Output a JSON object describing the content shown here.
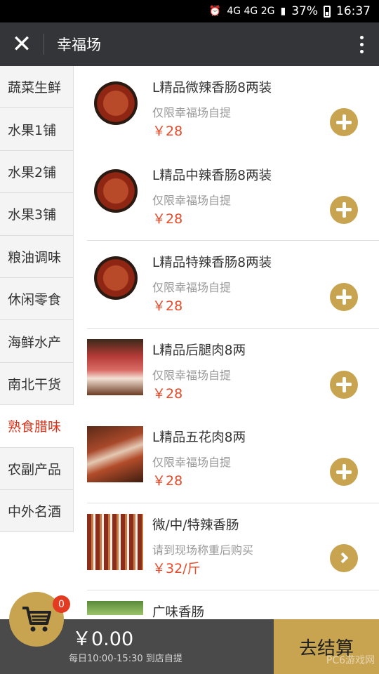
{
  "status_bar": {
    "network": "4G 4G 2G",
    "battery": "37%",
    "time": "16:37"
  },
  "header": {
    "title": "幸福场"
  },
  "sidebar": {
    "items": [
      {
        "label": "蔬菜生鲜"
      },
      {
        "label": "水果1铺"
      },
      {
        "label": "水果2铺"
      },
      {
        "label": "水果3铺"
      },
      {
        "label": "粮油调味"
      },
      {
        "label": "休闲零食"
      },
      {
        "label": "海鲜水产"
      },
      {
        "label": "南北干货"
      },
      {
        "label": "熟食腊味"
      },
      {
        "label": "农副产品"
      },
      {
        "label": "中外名酒"
      }
    ],
    "active_label": "熟食腊味"
  },
  "products": [
    {
      "name": "L精品微辣香肠8两装",
      "note": "仅限幸福场自提",
      "price": "￥28",
      "action": "plus-icon"
    },
    {
      "name": "L精品中辣香肠8两装",
      "note": "仅限幸福场自提",
      "price": "￥28",
      "action": "plus-icon"
    },
    {
      "name": "L精品特辣香肠8两装",
      "note": "仅限幸福场自提",
      "price": "￥28",
      "action": "plus-icon"
    },
    {
      "name": "L精品后腿肉8两",
      "note": "仅限幸福场自提",
      "price": "￥28",
      "action": "plus-icon"
    },
    {
      "name": "L精品五花肉8两",
      "note": "仅限幸福场自提",
      "price": "￥28",
      "action": "plus-icon"
    },
    {
      "name": "微/中/特辣香肠",
      "note": "请到现场称重后购买",
      "price": "￥32/斤",
      "action": "chevron-right-icon"
    },
    {
      "name": "广味香肠"
    }
  ],
  "cart": {
    "badge_count": "0",
    "total": "￥0.00",
    "hours": "每日10:00-15:30 到店自提",
    "checkout_label": "去结算"
  },
  "watermark": "PC6游戏网",
  "colors": {
    "accent": "#c8a350",
    "price": "#e64b2a",
    "active_category": "#d9341b",
    "header_bg": "#333539",
    "bottom_bg": "#4a4a4a"
  }
}
